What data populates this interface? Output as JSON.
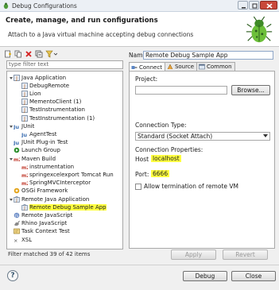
{
  "window": {
    "title": "Debug Configurations",
    "controls": [
      "minimize-icon",
      "maximize-icon",
      "close-icon"
    ]
  },
  "header": {
    "title": "Create, manage, and run configurations",
    "subtitle": "Attach to a Java virtual machine accepting debug connections",
    "logo_icon": "bug-icon"
  },
  "left": {
    "toolbar": [
      "new-config-icon",
      "duplicate-icon",
      "delete-icon",
      "collapse-all-icon",
      "filter-icon"
    ],
    "filter_placeholder": "type filter text",
    "tree": [
      {
        "label": "Java Application",
        "level": 0,
        "expanded": true,
        "icon": "java-app-icon"
      },
      {
        "label": "DebugRemote",
        "level": 1,
        "icon": "java-launch-icon"
      },
      {
        "label": "Lion",
        "level": 1,
        "icon": "java-launch-icon"
      },
      {
        "label": "MementoClient (1)",
        "level": 1,
        "icon": "java-launch-icon"
      },
      {
        "label": "TestInstrumentation",
        "level": 1,
        "icon": "java-launch-icon"
      },
      {
        "label": "TestInstrumentation (1)",
        "level": 1,
        "icon": "java-launch-icon"
      },
      {
        "label": "JUnit",
        "level": 0,
        "expanded": true,
        "icon": "junit-icon"
      },
      {
        "label": "AgentTest",
        "level": 1,
        "icon": "junit-icon"
      },
      {
        "label": "JUnit Plug-in Test",
        "level": 0,
        "icon": "junit-plugin-icon"
      },
      {
        "label": "Launch Group",
        "level": 0,
        "icon": "launch-group-icon"
      },
      {
        "label": "Maven Build",
        "level": 0,
        "expanded": true,
        "icon": "maven-icon"
      },
      {
        "label": "instrumentation",
        "level": 1,
        "icon": "maven-icon"
      },
      {
        "label": "springexcelexport Tomcat Run",
        "level": 1,
        "icon": "maven-icon"
      },
      {
        "label": "SpringMVCInterceptor",
        "level": 1,
        "icon": "maven-icon"
      },
      {
        "label": "OSGi Framework",
        "level": 0,
        "icon": "osgi-icon"
      },
      {
        "label": "Remote Java Application",
        "level": 0,
        "expanded": true,
        "icon": "remote-java-icon"
      },
      {
        "label": "Remote Debug Sample App",
        "level": 1,
        "icon": "remote-java-icon",
        "selected": true
      },
      {
        "label": "Remote JavaScript",
        "level": 0,
        "icon": "remote-js-icon"
      },
      {
        "label": "Rhino JavaScript",
        "level": 0,
        "icon": "rhino-icon"
      },
      {
        "label": "Task Context Test",
        "level": 0,
        "icon": "task-context-icon"
      },
      {
        "label": "XSL",
        "level": 0,
        "icon": "xsl-icon"
      }
    ],
    "status": "Filter matched 39 of 42 items"
  },
  "right": {
    "name_label": "Name:",
    "name_value": "Remote Debug Sample App",
    "tabs": [
      {
        "label": "Connect",
        "icon": "connect-icon",
        "active": true
      },
      {
        "label": "Source",
        "icon": "source-icon",
        "active": false
      },
      {
        "label": "Common",
        "icon": "common-icon",
        "active": false
      }
    ],
    "project_label": "Project:",
    "project_value": "",
    "browse_label": "Browse...",
    "connection_type_label": "Connection Type:",
    "connection_type_value": "Standard (Socket Attach)",
    "connection_props_label": "Connection Properties:",
    "host_label": "Host:",
    "host_value": "localhost",
    "port_label": "Port:",
    "port_value": "6666",
    "allow_termination_label": "Allow termination of remote VM",
    "allow_termination_checked": false,
    "apply_label": "Apply",
    "revert_label": "Revert"
  },
  "footer": {
    "help_icon": "help-icon",
    "help_glyph": "?",
    "debug_label": "Debug",
    "close_label": "Close"
  },
  "colors": {
    "highlight": "#ffff40",
    "header_bg": "#ffffff",
    "dialog_bg": "#f0f0f0",
    "close_button": "#c9483a"
  }
}
